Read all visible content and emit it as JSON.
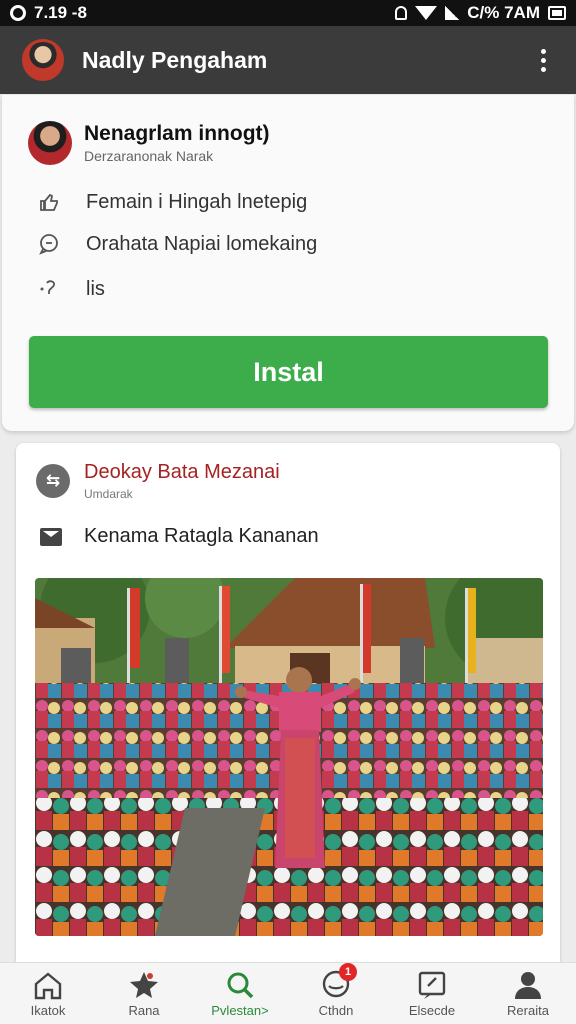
{
  "status_bar": {
    "left_text": "7.19 -8",
    "right_text": "C/% 7AM",
    "icons": [
      "ring-icon",
      "wifi-icon",
      "signal-icon",
      "battery-icon"
    ]
  },
  "app_bar": {
    "title": "Nadly Pengaham",
    "menu_icon": "kebab-menu-icon"
  },
  "app_card": {
    "name": "Nenagrlam innogt)",
    "developer": "Derzaranonak Narak",
    "permissions": [
      {
        "icon": "thumb-icon",
        "label": "Femain i Hingah lnetepig"
      },
      {
        "icon": "chat-bubble-icon",
        "label": "Orahata Napiai lomekaing"
      },
      {
        "icon": "question-icon",
        "label": "lis"
      }
    ],
    "install_label": "Instal",
    "accent_color": "#3dac4a"
  },
  "post_card": {
    "title": "Deokay Bata Mezanai",
    "subtitle": "Umdarak",
    "line_text": "Kenama Ratagla Kananan",
    "image_alt": "crowd-gathering-photo"
  },
  "bottom_nav": {
    "items": [
      {
        "icon": "home-icon",
        "label": "Ikatok"
      },
      {
        "icon": "star-icon",
        "label": "Rana"
      },
      {
        "icon": "search-icon",
        "label": "Pvlestan>"
      },
      {
        "icon": "chat-icon",
        "label": "Cthdn",
        "badge": "1"
      },
      {
        "icon": "edit-note-icon",
        "label": "Elsecde"
      },
      {
        "icon": "person-icon",
        "label": "Reraita"
      }
    ],
    "active_index": 2
  }
}
